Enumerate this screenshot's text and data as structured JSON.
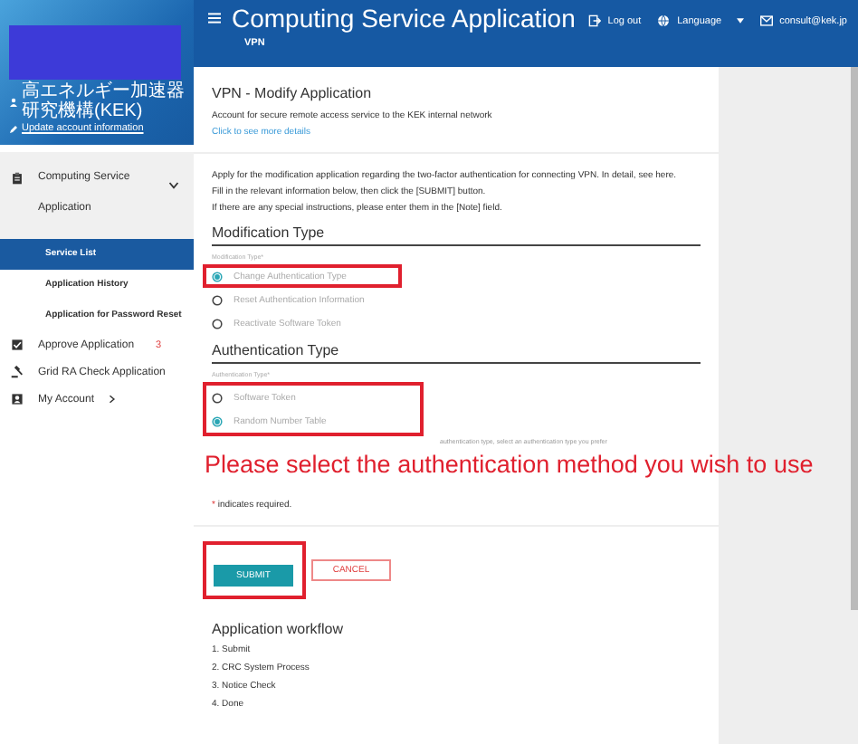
{
  "header": {
    "title": "Computing Service Application",
    "subtitle": "VPN",
    "actions": [
      {
        "kind": "logout",
        "label": "Log out"
      },
      {
        "kind": "language",
        "label": "Language"
      },
      {
        "kind": "mail",
        "label": "consult@kek.jp"
      }
    ]
  },
  "account": {
    "organization": "高エネルギー加速器研究機構(KEK)",
    "link": "Update account information"
  },
  "sidebar": {
    "items": [
      {
        "kind": "clipboard",
        "label": "Computing Service Application",
        "selected": true,
        "expanded": true,
        "children": [
          {
            "label": "Service List",
            "selected": true
          },
          {
            "label": "Application History",
            "selected": false
          },
          {
            "label": "Application for Password Reset",
            "selected": false
          }
        ]
      },
      {
        "kind": "check",
        "label": "Approve Application",
        "selected": false,
        "badge": "3"
      },
      {
        "kind": "gavel",
        "label": "Grid RA Check Application",
        "selected": false
      },
      {
        "kind": "account",
        "label": "My Account",
        "selected": false,
        "arrow": true
      }
    ]
  },
  "page": {
    "title": "VPN - Modify Application",
    "description": "Account for secure remote access service to the KEK internal network",
    "details_link": "Click to see more details",
    "instructions": [
      "Apply for the modification application regarding the two-factor authentication for connecting VPN. In detail, see here.",
      "Fill in the relevant information below, then click the [SUBMIT] button.",
      "If there are any special instructions, please enter them in the [Note] field."
    ],
    "sections": [
      {
        "heading": "Modification Type",
        "field_label": "Modification Type*",
        "options": [
          {
            "label": "Change Authentication Type",
            "selected": true,
            "highlight": true
          },
          {
            "label": "Reset Authentication Information",
            "selected": false
          },
          {
            "label": "Reactivate Software Token",
            "selected": false
          }
        ]
      },
      {
        "heading": "Authentication Type",
        "field_label": "Authentication Type*",
        "highlight": true,
        "options": [
          {
            "label": "Software Token",
            "selected": false
          },
          {
            "label": "Random Number Table",
            "selected": true
          }
        ],
        "hint": "authentication type, select an authentication type you prefer"
      }
    ],
    "required_note": "* indicates required.",
    "buttons": [
      {
        "kind": "primary",
        "label": "SUBMIT",
        "highlight": true
      },
      {
        "kind": "secondary",
        "label": "CANCEL"
      }
    ],
    "workflow": {
      "title": "Application workflow",
      "steps": [
        "1. Submit",
        "2. CRC System Process",
        "3. Notice Check",
        "4. Done"
      ]
    }
  },
  "annotation": {
    "message": "Please select the authentication method you wish to use"
  }
}
